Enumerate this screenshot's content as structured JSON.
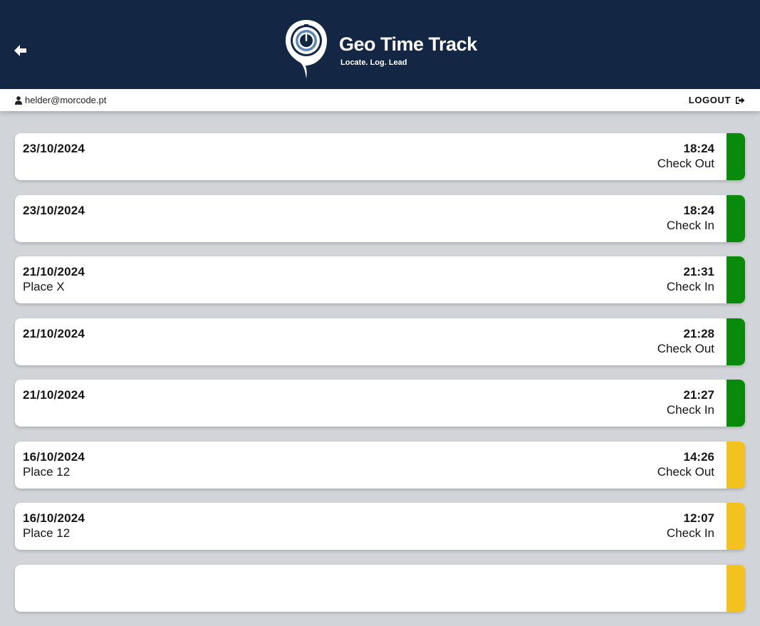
{
  "header": {
    "app_name": "Geo Time Track",
    "tagline": "Locate. Log. Lead",
    "background_color": "#132643"
  },
  "userbar": {
    "user_email": "helder@morcode.pt",
    "logout_label": "LOGOUT"
  },
  "status_colors": {
    "synced": "#0a8a0a",
    "pending": "#f3c21f"
  },
  "entries": [
    {
      "date": "23/10/2024",
      "place": "",
      "time": "18:24",
      "type": "Check Out",
      "status_color": "#0a8a0a"
    },
    {
      "date": "23/10/2024",
      "place": "",
      "time": "18:24",
      "type": "Check In",
      "status_color": "#0a8a0a"
    },
    {
      "date": "21/10/2024",
      "place": "Place X",
      "time": "21:31",
      "type": "Check In",
      "status_color": "#0a8a0a"
    },
    {
      "date": "21/10/2024",
      "place": "",
      "time": "21:28",
      "type": "Check Out",
      "status_color": "#0a8a0a"
    },
    {
      "date": "21/10/2024",
      "place": "",
      "time": "21:27",
      "type": "Check In",
      "status_color": "#0a8a0a"
    },
    {
      "date": "16/10/2024",
      "place": "Place 12",
      "time": "14:26",
      "type": "Check Out",
      "status_color": "#f3c21f"
    },
    {
      "date": "16/10/2024",
      "place": "Place 12",
      "time": "12:07",
      "type": "Check In",
      "status_color": "#f3c21f"
    },
    {
      "date": "",
      "place": "",
      "time": "",
      "type": "",
      "status_color": "#f3c21f"
    }
  ]
}
